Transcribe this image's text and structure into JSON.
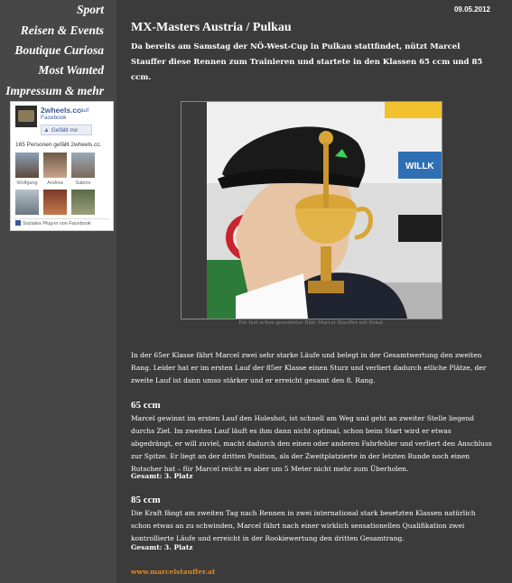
{
  "nav": {
    "items": [
      {
        "label": "Sport"
      },
      {
        "label": "Reisen & Events"
      },
      {
        "label": "Boutique Curiosa"
      },
      {
        "label": "Most Wanted"
      },
      {
        "label": "Impressum & mehr"
      }
    ]
  },
  "facebook": {
    "page_name": "2wheels.cc",
    "on_label": "auf",
    "network": "Facebook",
    "like_button": "Gefällt mir",
    "like_count_text": "165 Personen gefällt 2wheels.cc.",
    "fans": [
      {
        "name": "Wolfgang"
      },
      {
        "name": "Andrea"
      },
      {
        "name": "Sabine"
      },
      {
        "name": ""
      },
      {
        "name": ""
      },
      {
        "name": ""
      }
    ],
    "plugin_text": "Soziales Plug-in von Facebook"
  },
  "post": {
    "date": "09.05.2012",
    "title": "MX-Masters Austria / Pulkau",
    "intro": "Da bereits am Samstag der NÖ-West-Cup in Pulkau stattfindet, nützt Marcel Stauffer diese Rennen zum Trainieren und startete in den Klassen 65 ccm und 85 ccm.",
    "image_caption": "Ein fast schon gewohntes Bild: Marcel Stauffer mit Pokal",
    "paragraph1": "In der 65er Klasse fährt Marcel zwei sehr starke Läufe und belegt in der Gesamtwertung den zweiten Rang. Leider hat er im ersten Lauf der 85er Klasse einen Sturz und verliert dadurch etliche Plätze, der zweite Lauf ist dann umso stärker und er erreicht gesamt den 8. Rang.",
    "section1_heading": "65 ccm",
    "section1_text": "Marcel gewinnt im ersten Lauf den Holeshot, ist schnell am Weg und geht an zweiter Stelle liegend durchs Ziel. Im zweiten Lauf läuft es ihm dann nicht optimal, schon beim Start wird er etwas abgedrängt, er will zuviel, macht dadurch  den einen oder anderen Fahrfehler und verliert den Anschluss zur Spitze. Er liegt an der dritten Position, als der Zweitplatzierte in der letzten Runde noch einen Rutscher hat – für Marcel reicht es aber um 5 Meter nicht mehr zum Überholen.",
    "section1_result": "Gesamt: 3. Platz",
    "section2_heading": "85 ccm",
    "section2_text": "Die Kraft fängt am zweiten Tag nach Rennen in zwei international stark besetzten Klassen natürlich schon etwas an zu schwinden, Marcel fährt nach einer wirklich sensationellen Qualifikation zwei kontrollierte Läufe und erreicht in der Rookiewertung den dritten Gesamtrang.",
    "section2_result": "Gesamt: 3. Platz",
    "footer_link": "www.marcelstauffer.at"
  },
  "colors": {
    "background": "#3b3b3b",
    "sidebar": "#474747",
    "link_accent": "#e08a1e",
    "facebook_blue": "#3b5998"
  }
}
